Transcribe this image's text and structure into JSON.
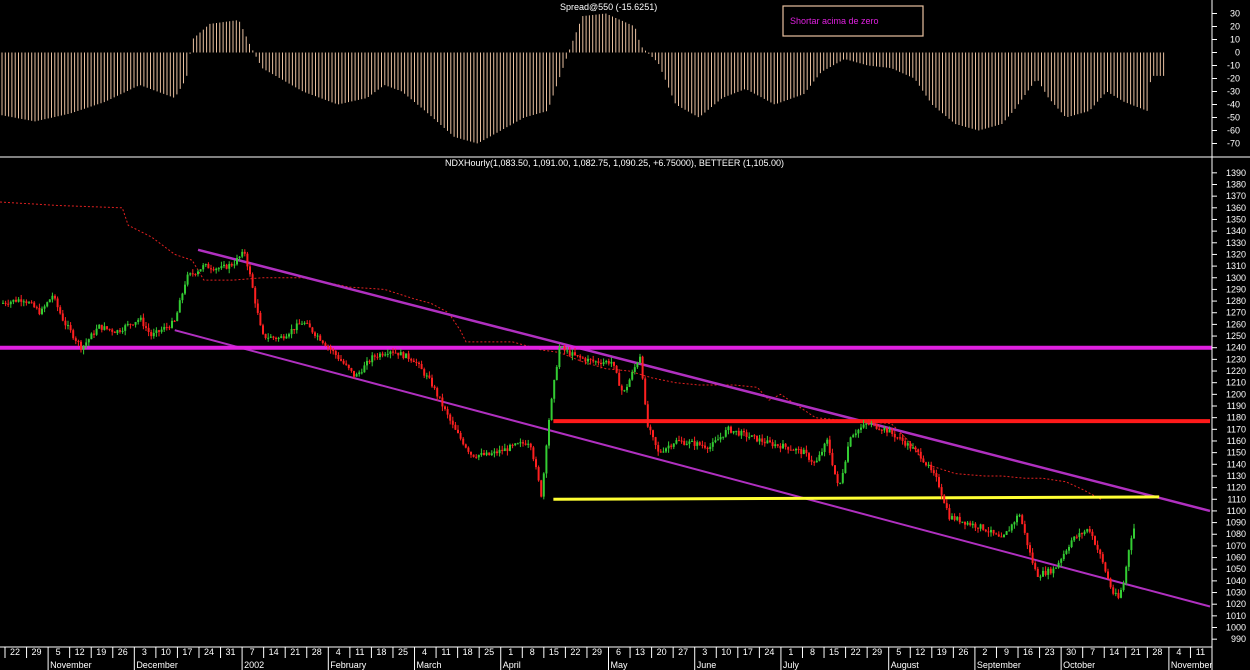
{
  "colors": {
    "background": "#000000",
    "axis_text": "#ffffff",
    "divider": "#ffffff",
    "bull_candle": "#33cc33",
    "bear_candle": "#ff2020",
    "osc_bar": "#e8c0a0",
    "envelope": "#e02020",
    "channel": "#b030c0",
    "support_240": "#e020e0",
    "red_line": "#ff1a1a",
    "yellow_line": "#ffff33",
    "annotation": "#e020e0"
  },
  "top_panel": {
    "title": "Spread@550 (-15.6251)",
    "annotation": "Shortar acima de zero"
  },
  "main_panel": {
    "title": "NDXHourly(1,083.50, 1,091.00, 1,082.75, 1,090.25, +6.75000), BETTEER (1,105.00)"
  },
  "chart_data": [
    {
      "type": "bar",
      "name": "Spread@550",
      "ylim": [
        -75,
        35
      ],
      "yticks": [
        30,
        20,
        10,
        0,
        -10,
        -20,
        -30,
        -40,
        -50,
        -60,
        -70
      ],
      "points": [
        [
          0,
          -48
        ],
        [
          0.03,
          -53
        ],
        [
          0.06,
          -47
        ],
        [
          0.09,
          -38
        ],
        [
          0.12,
          -25
        ],
        [
          0.15,
          -35
        ],
        [
          0.16,
          -20
        ],
        [
          0.165,
          10
        ],
        [
          0.18,
          22
        ],
        [
          0.205,
          25
        ],
        [
          0.215,
          5
        ],
        [
          0.225,
          -12
        ],
        [
          0.26,
          -30
        ],
        [
          0.29,
          -40
        ],
        [
          0.315,
          -35
        ],
        [
          0.33,
          -25
        ],
        [
          0.345,
          -30
        ],
        [
          0.365,
          -45
        ],
        [
          0.39,
          -65
        ],
        [
          0.41,
          -70
        ],
        [
          0.43,
          -60
        ],
        [
          0.45,
          -50
        ],
        [
          0.47,
          -45
        ],
        [
          0.49,
          5
        ],
        [
          0.5,
          28
        ],
        [
          0.52,
          30
        ],
        [
          0.545,
          20
        ],
        [
          0.55,
          5
        ],
        [
          0.565,
          -8
        ],
        [
          0.58,
          -40
        ],
        [
          0.6,
          -50
        ],
        [
          0.62,
          -35
        ],
        [
          0.64,
          -28
        ],
        [
          0.665,
          -40
        ],
        [
          0.69,
          -32
        ],
        [
          0.705,
          -15
        ],
        [
          0.725,
          -5
        ],
        [
          0.745,
          -10
        ],
        [
          0.765,
          -12
        ],
        [
          0.785,
          -20
        ],
        [
          0.8,
          -40
        ],
        [
          0.82,
          -55
        ],
        [
          0.84,
          -60
        ],
        [
          0.86,
          -55
        ],
        [
          0.87,
          -45
        ],
        [
          0.89,
          -20
        ],
        [
          0.9,
          -35
        ],
        [
          0.915,
          -50
        ],
        [
          0.935,
          -45
        ],
        [
          0.95,
          -30
        ],
        [
          0.965,
          -38
        ],
        [
          0.985,
          -45
        ],
        [
          0.988,
          -18
        ],
        [
          1,
          -18
        ]
      ]
    },
    {
      "type": "line",
      "name": "NDXHourly",
      "ylim": [
        985,
        1395
      ],
      "yticks": [
        1390,
        1380,
        1370,
        1360,
        1350,
        1340,
        1330,
        1320,
        1310,
        1300,
        1290,
        1280,
        1270,
        1260,
        1250,
        1240,
        1230,
        1220,
        1210,
        1200,
        1190,
        1180,
        1170,
        1160,
        1150,
        1140,
        1130,
        1120,
        1110,
        1100,
        1090,
        1080,
        1070,
        1060,
        1050,
        1040,
        1030,
        1020,
        1010,
        1000,
        990
      ],
      "x_day_labels": [
        "22",
        "29",
        "5",
        "12",
        "19",
        "26",
        "3",
        "10",
        "17",
        "24",
        "31",
        "7",
        "14",
        "21",
        "28",
        "4",
        "11",
        "18",
        "25",
        "4",
        "11",
        "18",
        "25",
        "1",
        "8",
        "15",
        "22",
        "29",
        "6",
        "13",
        "20",
        "27",
        "3",
        "10",
        "17",
        "24",
        "1",
        "8",
        "15",
        "22",
        "29",
        "5",
        "12",
        "19",
        "26",
        "2",
        "9",
        "16",
        "23",
        "30",
        "7",
        "14",
        "21",
        "28",
        "4",
        "11"
      ],
      "x_month_labels": [
        "November",
        "December",
        "2002",
        "February",
        "March",
        "April",
        "May",
        "June",
        "July",
        "August",
        "September",
        "October",
        "November"
      ],
      "price": [
        [
          0,
          1278
        ],
        [
          0.02,
          1282
        ],
        [
          0.035,
          1270
        ],
        [
          0.045,
          1285
        ],
        [
          0.055,
          1262
        ],
        [
          0.07,
          1240
        ],
        [
          0.085,
          1258
        ],
        [
          0.1,
          1254
        ],
        [
          0.12,
          1265
        ],
        [
          0.13,
          1250
        ],
        [
          0.15,
          1262
        ],
        [
          0.16,
          1300
        ],
        [
          0.175,
          1310
        ],
        [
          0.19,
          1308
        ],
        [
          0.2,
          1312
        ],
        [
          0.21,
          1322
        ],
        [
          0.215,
          1300
        ],
        [
          0.225,
          1250
        ],
        [
          0.24,
          1248
        ],
        [
          0.26,
          1262
        ],
        [
          0.275,
          1248
        ],
        [
          0.29,
          1232
        ],
        [
          0.305,
          1215
        ],
        [
          0.32,
          1232
        ],
        [
          0.335,
          1238
        ],
        [
          0.355,
          1230
        ],
        [
          0.37,
          1210
        ],
        [
          0.39,
          1170
        ],
        [
          0.405,
          1148
        ],
        [
          0.42,
          1148
        ],
        [
          0.44,
          1155
        ],
        [
          0.455,
          1160
        ],
        [
          0.465,
          1112
        ],
        [
          0.47,
          1170
        ],
        [
          0.48,
          1240
        ],
        [
          0.495,
          1232
        ],
        [
          0.51,
          1228
        ],
        [
          0.525,
          1228
        ],
        [
          0.535,
          1200
        ],
        [
          0.55,
          1235
        ],
        [
          0.555,
          1175
        ],
        [
          0.565,
          1150
        ],
        [
          0.58,
          1160
        ],
        [
          0.595,
          1158
        ],
        [
          0.61,
          1155
        ],
        [
          0.625,
          1170
        ],
        [
          0.64,
          1165
        ],
        [
          0.66,
          1158
        ],
        [
          0.675,
          1155
        ],
        [
          0.69,
          1150
        ],
        [
          0.7,
          1140
        ],
        [
          0.71,
          1160
        ],
        [
          0.72,
          1118
        ],
        [
          0.73,
          1165
        ],
        [
          0.745,
          1175
        ],
        [
          0.76,
          1170
        ],
        [
          0.775,
          1160
        ],
        [
          0.79,
          1148
        ],
        [
          0.805,
          1125
        ],
        [
          0.815,
          1095
        ],
        [
          0.83,
          1090
        ],
        [
          0.845,
          1085
        ],
        [
          0.86,
          1075
        ],
        [
          0.875,
          1098
        ],
        [
          0.885,
          1060
        ],
        [
          0.89,
          1045
        ],
        [
          0.905,
          1050
        ],
        [
          0.92,
          1075
        ],
        [
          0.935,
          1085
        ],
        [
          0.945,
          1060
        ],
        [
          0.955,
          1030
        ],
        [
          0.96,
          1025
        ],
        [
          0.965,
          1040
        ],
        [
          0.97,
          1075
        ],
        [
          0.975,
          1090
        ]
      ],
      "envelope": [
        [
          0,
          1365
        ],
        [
          0.05,
          1362
        ],
        [
          0.105,
          1360
        ],
        [
          0.11,
          1345
        ],
        [
          0.13,
          1335
        ],
        [
          0.15,
          1320
        ],
        [
          0.165,
          1315
        ],
        [
          0.175,
          1298
        ],
        [
          0.2,
          1298
        ],
        [
          0.225,
          1300
        ],
        [
          0.245,
          1300
        ],
        [
          0.26,
          1300
        ],
        [
          0.285,
          1295
        ],
        [
          0.3,
          1292
        ],
        [
          0.33,
          1290
        ],
        [
          0.355,
          1282
        ],
        [
          0.37,
          1278
        ],
        [
          0.385,
          1270
        ],
        [
          0.395,
          1255
        ],
        [
          0.4,
          1245
        ],
        [
          0.44,
          1245
        ],
        [
          0.465,
          1238
        ],
        [
          0.48,
          1236
        ],
        [
          0.5,
          1228
        ],
        [
          0.52,
          1222
        ],
        [
          0.54,
          1220
        ],
        [
          0.56,
          1214
        ],
        [
          0.58,
          1210
        ],
        [
          0.6,
          1208
        ],
        [
          0.63,
          1208
        ],
        [
          0.65,
          1206
        ],
        [
          0.66,
          1195
        ],
        [
          0.67,
          1200
        ],
        [
          0.7,
          1180
        ],
        [
          0.72,
          1178
        ],
        [
          0.75,
          1176
        ],
        [
          0.765,
          1175
        ],
        [
          0.78,
          1160
        ],
        [
          0.795,
          1140
        ],
        [
          0.82,
          1132
        ],
        [
          0.845,
          1130
        ],
        [
          0.86,
          1130
        ],
        [
          0.88,
          1128
        ],
        [
          0.895,
          1128
        ],
        [
          0.915,
          1125
        ],
        [
          0.93,
          1118
        ],
        [
          0.945,
          1110
        ]
      ],
      "lines": [
        {
          "name": "upper_channel",
          "from": [
            0.17,
            1324
          ],
          "to": [
            1,
            1100
          ]
        },
        {
          "name": "lower_channel",
          "from": [
            0.15,
            1255
          ],
          "to": [
            1,
            1018
          ]
        },
        {
          "name": "support_1240",
          "from": [
            0,
            1240
          ],
          "to": [
            1,
            1240
          ]
        },
        {
          "name": "resistance_1177",
          "from": [
            0.475,
            1177
          ],
          "to": [
            1,
            1177
          ]
        },
        {
          "name": "yellow_1111",
          "from": [
            0.475,
            1110
          ],
          "to": [
            0.995,
            1112
          ]
        }
      ]
    }
  ]
}
